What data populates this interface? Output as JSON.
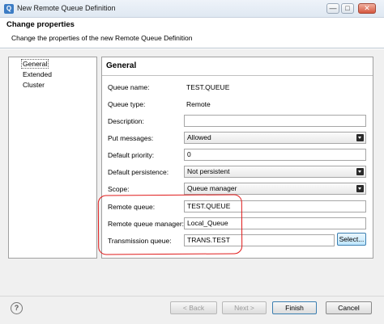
{
  "window": {
    "title": "New Remote Queue Definition",
    "minimize": "—",
    "maximize": "□",
    "close": "✕"
  },
  "header": {
    "title": "Change properties",
    "subtitle": "Change the properties of the new Remote Queue Definition"
  },
  "nav": {
    "items": [
      {
        "label": "General",
        "selected": true
      },
      {
        "label": "Extended",
        "selected": false
      },
      {
        "label": "Cluster",
        "selected": false
      }
    ]
  },
  "panel": {
    "title": "General",
    "fields": {
      "queue_name": {
        "label": "Queue name:",
        "value": "TEST.QUEUE"
      },
      "queue_type": {
        "label": "Queue type:",
        "value": "Remote"
      },
      "description": {
        "label": "Description:",
        "value": ""
      },
      "put_messages": {
        "label": "Put messages:",
        "value": "Allowed"
      },
      "default_priority": {
        "label": "Default priority:",
        "value": "0"
      },
      "default_persistence": {
        "label": "Default persistence:",
        "value": "Not persistent"
      },
      "scope": {
        "label": "Scope:",
        "value": "Queue manager"
      },
      "remote_queue": {
        "label": "Remote queue:",
        "value": "TEST.QUEUE"
      },
      "remote_queue_manager": {
        "label": "Remote queue manager:",
        "value": "Local_Queue"
      },
      "transmission_queue": {
        "label": "Transmission queue:",
        "value": "TRANS.TEST"
      }
    },
    "select_label": "Select..."
  },
  "footer": {
    "help": "?",
    "back": "< Back",
    "next": "Next >",
    "finish": "Finish",
    "cancel": "Cancel"
  },
  "colors": {
    "annotation": "#e01a1a",
    "accent": "#3c7fb1"
  }
}
